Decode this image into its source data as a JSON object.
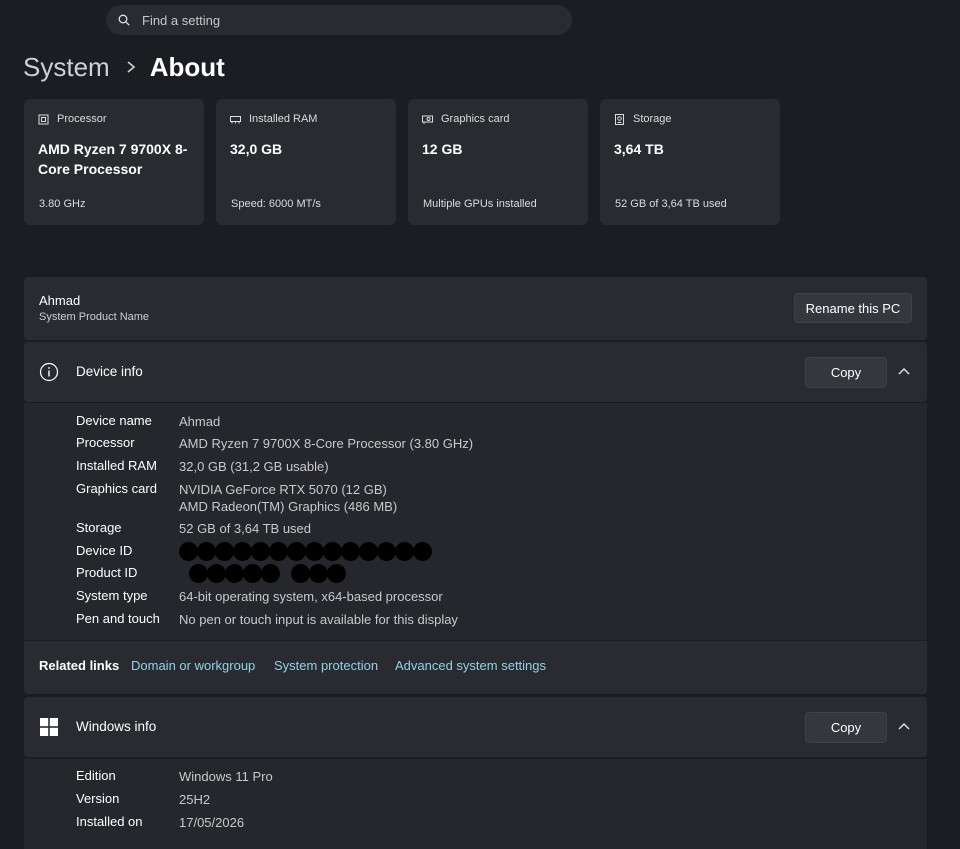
{
  "search": {
    "placeholder": "Find a setting",
    "icon": "search-icon"
  },
  "breadcrumb": {
    "parent": "System",
    "current": "About"
  },
  "cards": [
    {
      "icon": "processor-icon",
      "label": "Processor",
      "value": "AMD Ryzen 7 9700X 8-Core Processor",
      "foot": "3.80 GHz"
    },
    {
      "icon": "ram-icon",
      "label": "Installed RAM",
      "value": "32,0 GB",
      "foot": "Speed: 6000 MT/s"
    },
    {
      "icon": "graphics-card-icon",
      "label": "Graphics card",
      "value": "12 GB",
      "foot": "Multiple GPUs installed"
    },
    {
      "icon": "storage-icon",
      "label": "Storage",
      "value": "3,64 TB",
      "foot": "52 GB of 3,64 TB used"
    }
  ],
  "pc": {
    "name": "Ahmad",
    "sub": "System Product Name",
    "rename_label": "Rename this PC"
  },
  "device_info": {
    "title": "Device info",
    "copy_label": "Copy",
    "rows": [
      {
        "key": "Device name",
        "value": "Ahmad"
      },
      {
        "key": "Processor",
        "value": "AMD Ryzen 7 9700X 8-Core Processor (3.80 GHz)"
      },
      {
        "key": "Installed RAM",
        "value": "32,0 GB (31,2 GB usable)"
      },
      {
        "key": "Graphics card",
        "value": "NVIDIA GeForce RTX 5070 (12 GB)",
        "value2": "AMD Radeon(TM) Graphics (486 MB)"
      },
      {
        "key": "Storage",
        "value": "52 GB of 3,64 TB used"
      },
      {
        "key": "Device ID",
        "value": ""
      },
      {
        "key": "Product ID",
        "value": ""
      },
      {
        "key": "System type",
        "value": "64-bit operating system, x64-based processor"
      },
      {
        "key": "Pen and touch",
        "value": "No pen or touch input is available for this display"
      }
    ]
  },
  "related_links": {
    "label": "Related links",
    "links": [
      "Domain or workgroup",
      "System protection",
      "Advanced system settings"
    ]
  },
  "windows_info": {
    "title": "Windows info",
    "copy_label": "Copy",
    "rows": [
      {
        "key": "Edition",
        "value": "Windows 11 Pro"
      },
      {
        "key": "Version",
        "value": "25H2"
      },
      {
        "key": "Installed on",
        "value": "17/05/2026"
      }
    ]
  },
  "colors": {
    "background": "#1c1d22",
    "panel": "#2a2b31",
    "link": "#8fd3e6"
  }
}
